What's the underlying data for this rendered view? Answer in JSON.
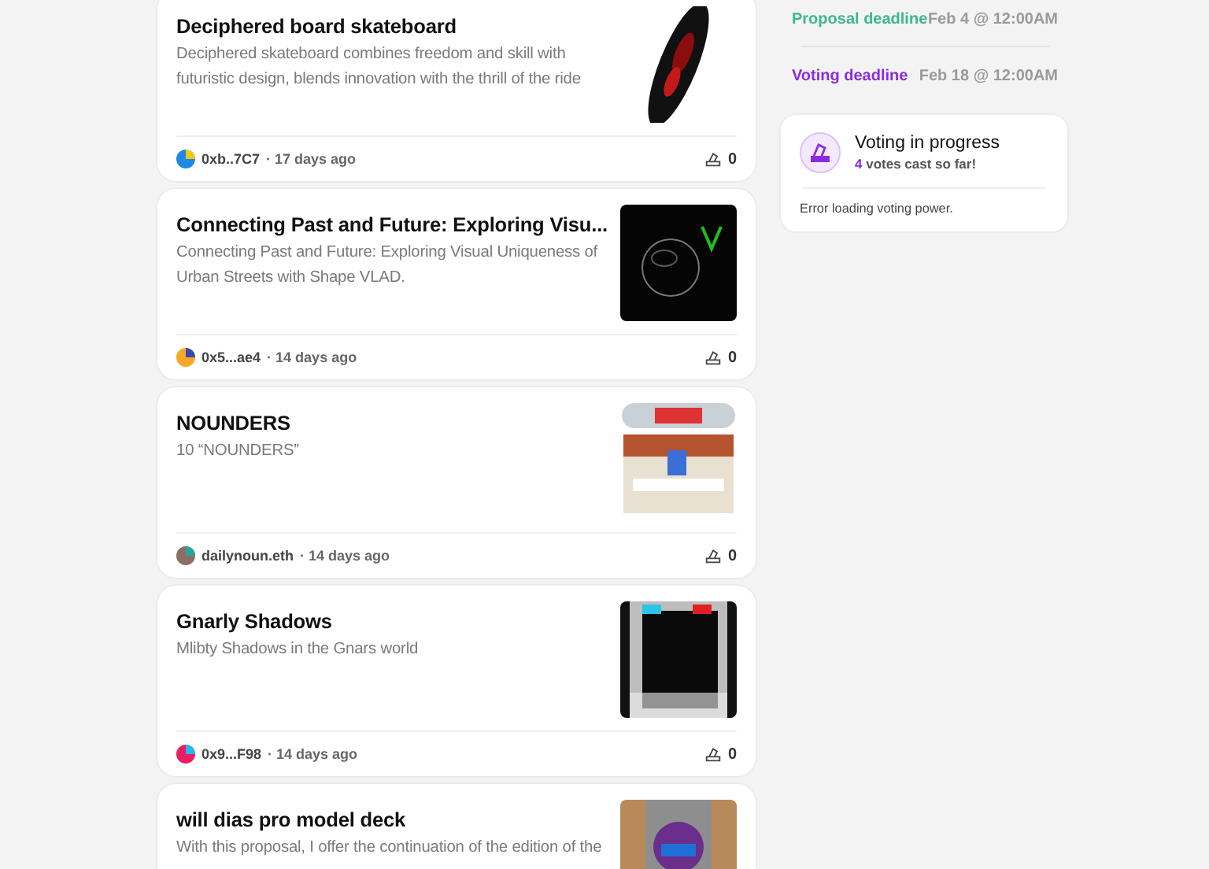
{
  "proposals": [
    {
      "title": "Deciphered board skateboard",
      "description": "Deciphered skateboard combines freedom and skill with futuristic design, blends innovation with the thrill of the ride",
      "author": "0xb..7C7",
      "age": "· 17 days ago",
      "votes": "0"
    },
    {
      "title": "Connecting Past and Future: Exploring Visu...",
      "description": "Connecting Past and Future: Exploring Visual Uniqueness of Urban Streets with Shape VLAD.",
      "author": "0x5...ae4",
      "age": "· 14 days ago",
      "votes": "0"
    },
    {
      "title": "NOUNDERS",
      "description": "10 “NOUNDERS”",
      "author": "dailynoun.eth",
      "age": "· 14 days ago",
      "votes": "0"
    },
    {
      "title": "Gnarly Shadows",
      "description": "Mlibty Shadows in the Gnars world",
      "author": "0x9...F98",
      "age": "· 14 days ago",
      "votes": "0"
    },
    {
      "title": "will dias pro model deck",
      "description": "With this proposal, I offer the continuation of the edition of the"
    }
  ],
  "deadlines": [
    {
      "kind": "proposal",
      "label": "Proposal deadline",
      "value": "Feb 4 @ 12:00AM"
    },
    {
      "kind": "voting",
      "label": "Voting deadline",
      "value": "Feb 18 @ 12:00AM"
    }
  ],
  "status": {
    "title": "Voting in progress",
    "count": "4",
    "count_text": "votes cast so far!",
    "message": "Error loading voting power."
  }
}
